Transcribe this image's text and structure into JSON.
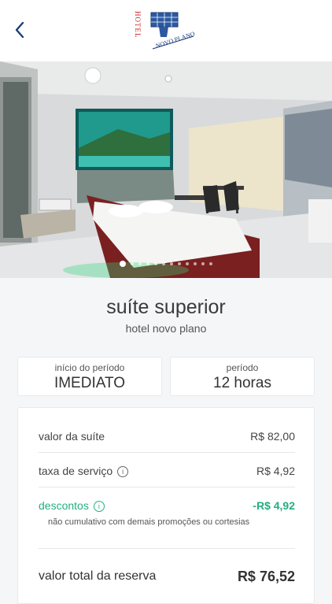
{
  "header": {
    "logo_text_vertical": "HOTEL",
    "logo_text_slanted": "NOVO PLANO"
  },
  "gallery": {
    "image_count": 12,
    "active_index": 0
  },
  "suite": {
    "name": "suíte superior",
    "hotel": "hotel novo plano"
  },
  "booking": {
    "start_label": "início do período",
    "start_value": "IMEDIATO",
    "period_label": "período",
    "period_value": "12 horas"
  },
  "summary": {
    "suite_value_label": "valor da suíte",
    "suite_value": "R$ 82,00",
    "service_fee_label": "taxa de serviço",
    "service_fee": "R$ 4,92",
    "discounts_label": "descontos",
    "discounts_value": "-R$ 4,92",
    "discounts_note": "não cumulativo com demais promoções ou cortesias",
    "total_label": "valor total da reserva",
    "total_value": "R$ 76,52"
  },
  "colors": {
    "accent_blue": "#1c3f7a",
    "logo_red": "#c8202c",
    "discount_green": "#22b07d"
  }
}
